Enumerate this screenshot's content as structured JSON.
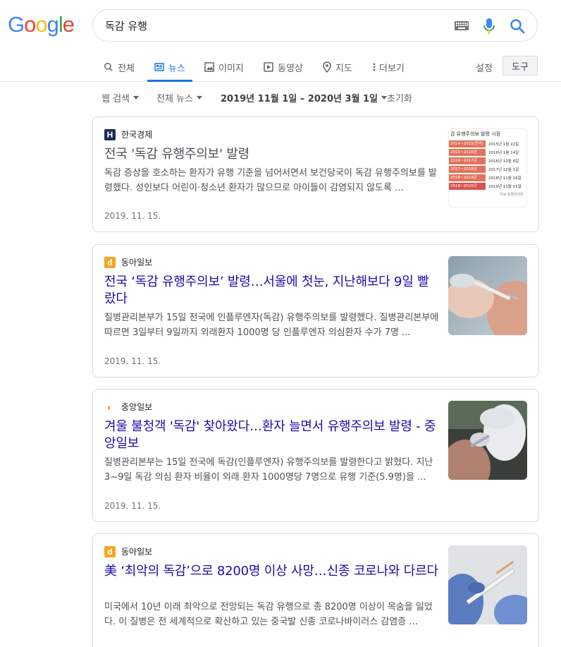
{
  "logo": {
    "letters": [
      "G",
      "o",
      "o",
      "g",
      "l",
      "e"
    ],
    "colors": [
      "#4285f4",
      "#ea4335",
      "#fbbc05",
      "#4285f4",
      "#34a853",
      "#ea4335"
    ]
  },
  "search": {
    "query": "독감 유행"
  },
  "tabs": [
    {
      "label": "전체",
      "icon": "search-icon"
    },
    {
      "label": "뉴스",
      "icon": "news-icon",
      "active": true
    },
    {
      "label": "이미지",
      "icon": "image-icon"
    },
    {
      "label": "동영상",
      "icon": "video-icon"
    },
    {
      "label": "지도",
      "icon": "map-pin-icon"
    },
    {
      "label": "더보기",
      "icon": "more-vert-icon"
    }
  ],
  "settings_label": "설정",
  "tools_label": "도구",
  "filters": {
    "web_search": "웹 검색",
    "all_news": "전체 뉴스",
    "date_range": "2019년 11월 1일 – 2020년 3월 1일",
    "reset": "초기화"
  },
  "colors": {
    "link": "#1a0dab",
    "visited": "#4d5156",
    "accent": "#1a73e8"
  },
  "results": [
    {
      "source": "한국경제",
      "source_logo": "H",
      "title": "전국 '독감 유행주의보' 발령",
      "snippet": "독감 증상을 호소하는 환자가 유행 기준을 넘어서면서 보건당국이 독감 유행주의보를 발령했다. 성인보다 어린이·청소년 환자가 많으므로 아이들이 감염되지 않도록 ...",
      "date": "2019. 11. 15.",
      "thumb_table": {
        "title": "감 유행주의보 발령 시점",
        "rows": [
          [
            "2014~2015(한겨)",
            "2015년 1월 22일"
          ],
          [
            "2015~2016년",
            "2016년 1월 14일"
          ],
          [
            "2016~2017년",
            "2016년 12월 8일"
          ],
          [
            "2017~2018년",
            "2017년 12월 1일"
          ],
          [
            "2018~2019년",
            "2018년 11월 16일"
          ],
          [
            "2019~2020년",
            "2019년 11월 15일"
          ]
        ],
        "footer": "자료:질병관리본"
      }
    },
    {
      "source": "동아일보",
      "source_logo": "d",
      "title": "전국 ‘독감 유행주의보’ 발령…서울에 첫눈, 지난해보다 9일 빨랐다",
      "snippet": "질병관리본부가 15일 전국에 인플루엔자(독감) 유행주의보를 발령했다. 질병관리본부에 따르면 3일부터 9일까지 외래환자 1000명 당 인플루엔자 의심환자 수가 7명 ...",
      "date": "2019. 11. 15."
    },
    {
      "source": "중앙일보",
      "source_logo": "◐",
      "title": "겨울 불청객 '독감' 찾아왔다…환자 늘면서 유행주의보 발령 - 중앙일보",
      "snippet": "질병관리본부는 15일 전국에 독감(인플루엔자) 유행주의보를 발령한다고 밝혔다. 지난 3~9일 독감 의심 환자 비율이 외래 환자 1000명당 7명으로 유행 기준(5.9명)을 ...",
      "date": "2019. 11. 15."
    },
    {
      "source": "동아일보",
      "source_logo": "d",
      "title": "美 ‘최악의 독감’으로 8200명 이상 사망…신종 코로나와 다르다",
      "snippet": "미국에서 10년 이래 최악으로 전망되는 독감 유행으로 총 8200명 이상이 목숨을 잃었다. 이 질병은 전 세계적으로 확산하고 있는 중국발 신종 코로나바이러스 감염증 ...",
      "date": ""
    }
  ]
}
